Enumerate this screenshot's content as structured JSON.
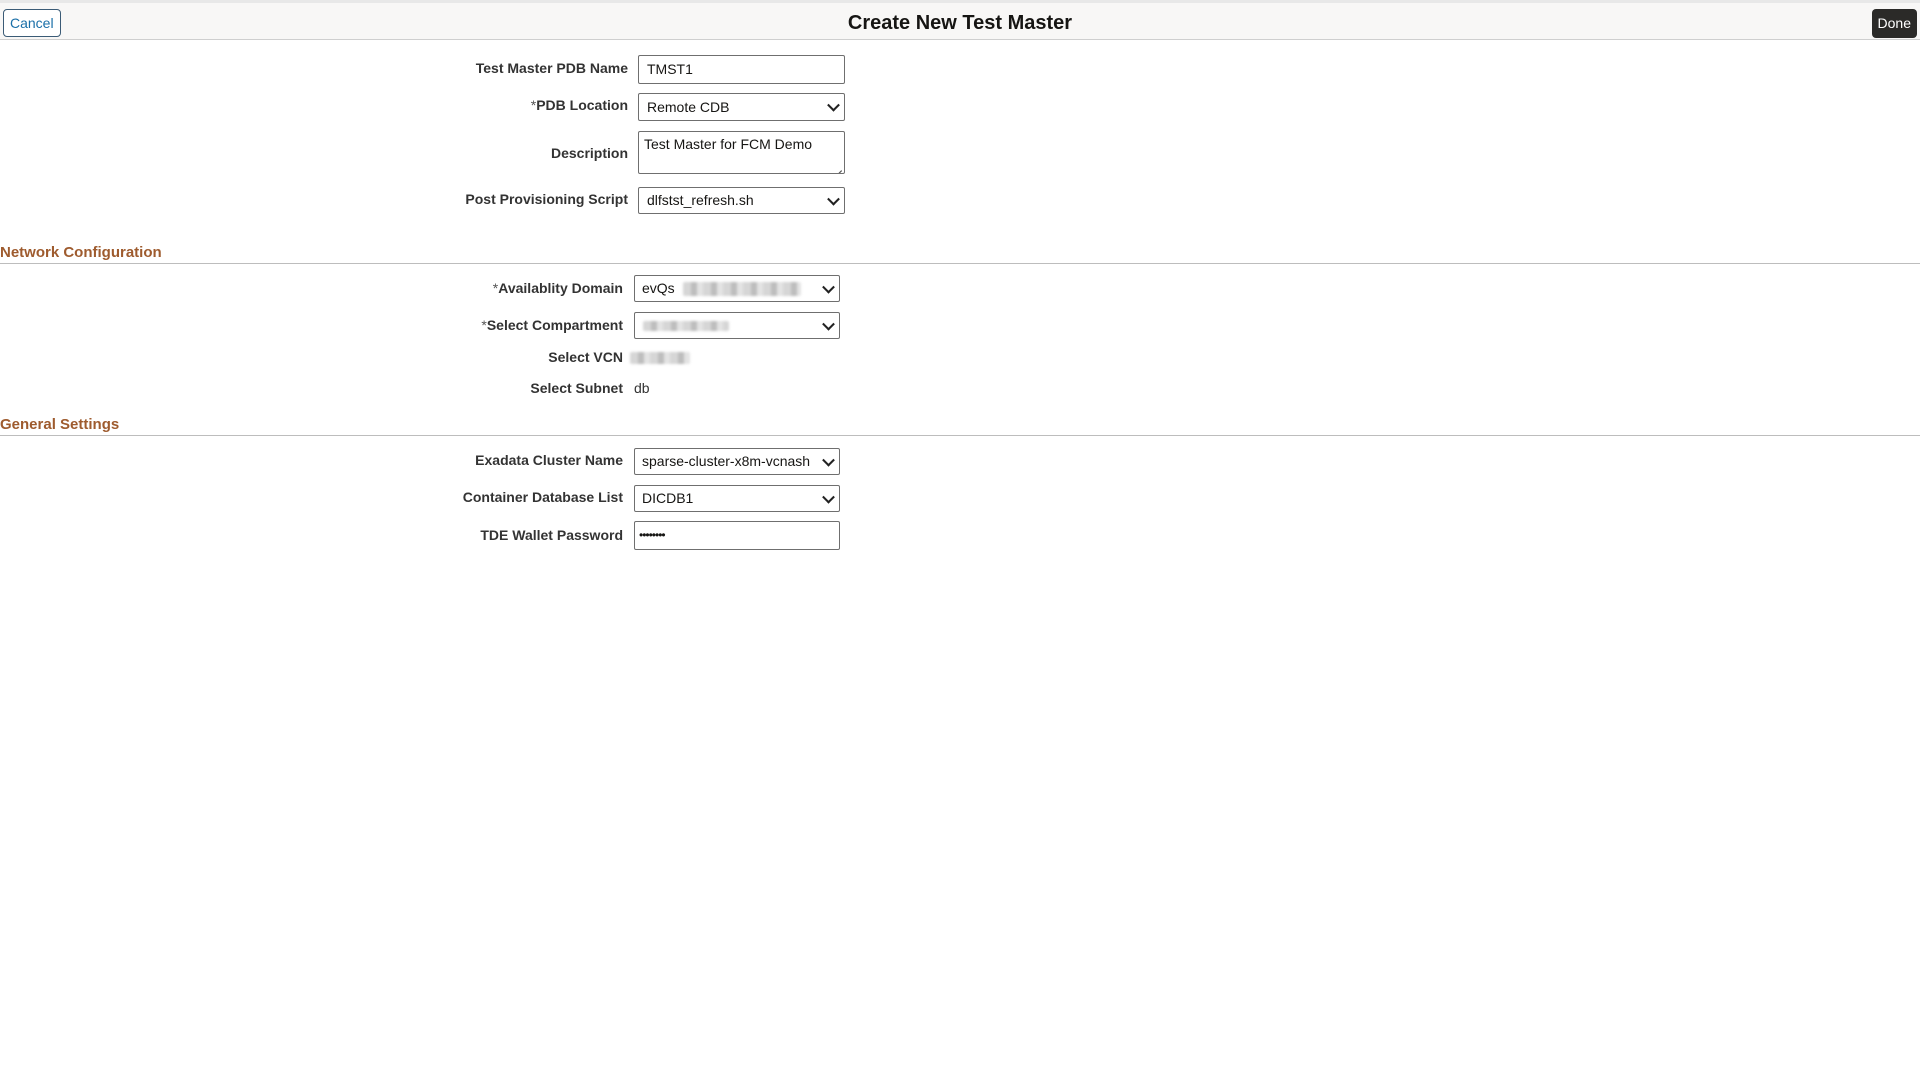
{
  "header": {
    "title": "Create New Test Master",
    "cancel_label": "Cancel",
    "done_label": "Done"
  },
  "form": {
    "test_master_pdb_name": {
      "label": "Test Master PDB Name",
      "value": "TMST1"
    },
    "pdb_location": {
      "required_mark": "*",
      "label": "PDB Location",
      "value": "Remote CDB"
    },
    "description": {
      "label": "Description",
      "value": "Test Master for FCM Demo"
    },
    "post_provisioning_script": {
      "label": "Post Provisioning Script",
      "value": "dlfstst_refresh.sh"
    }
  },
  "network_configuration": {
    "section_title": "Network Configuration",
    "availability_domain": {
      "required_mark": "*",
      "label": "Availablity Domain",
      "value": "evQs"
    },
    "select_compartment": {
      "required_mark": "*",
      "label": "Select Compartment",
      "value": ""
    },
    "select_vcn": {
      "label": "Select VCN",
      "value": ""
    },
    "select_subnet": {
      "label": "Select Subnet",
      "value": "db"
    }
  },
  "general_settings": {
    "section_title": "General Settings",
    "exadata_cluster_name": {
      "label": "Exadata Cluster Name",
      "value": "sparse-cluster-x8m-vcnash"
    },
    "container_database_list": {
      "label": "Container Database List",
      "value": "DICDB1"
    },
    "tde_wallet_password": {
      "label": "TDE Wallet Password",
      "value": "••••••••"
    }
  },
  "icons": {
    "dropdown": "chevron-down-icon",
    "resize": "resize-handle-icon"
  },
  "colors": {
    "section_title": "#9e5b2e",
    "done_button_bg": "#2b2a28",
    "cancel_button_text": "#1a6fa8"
  }
}
